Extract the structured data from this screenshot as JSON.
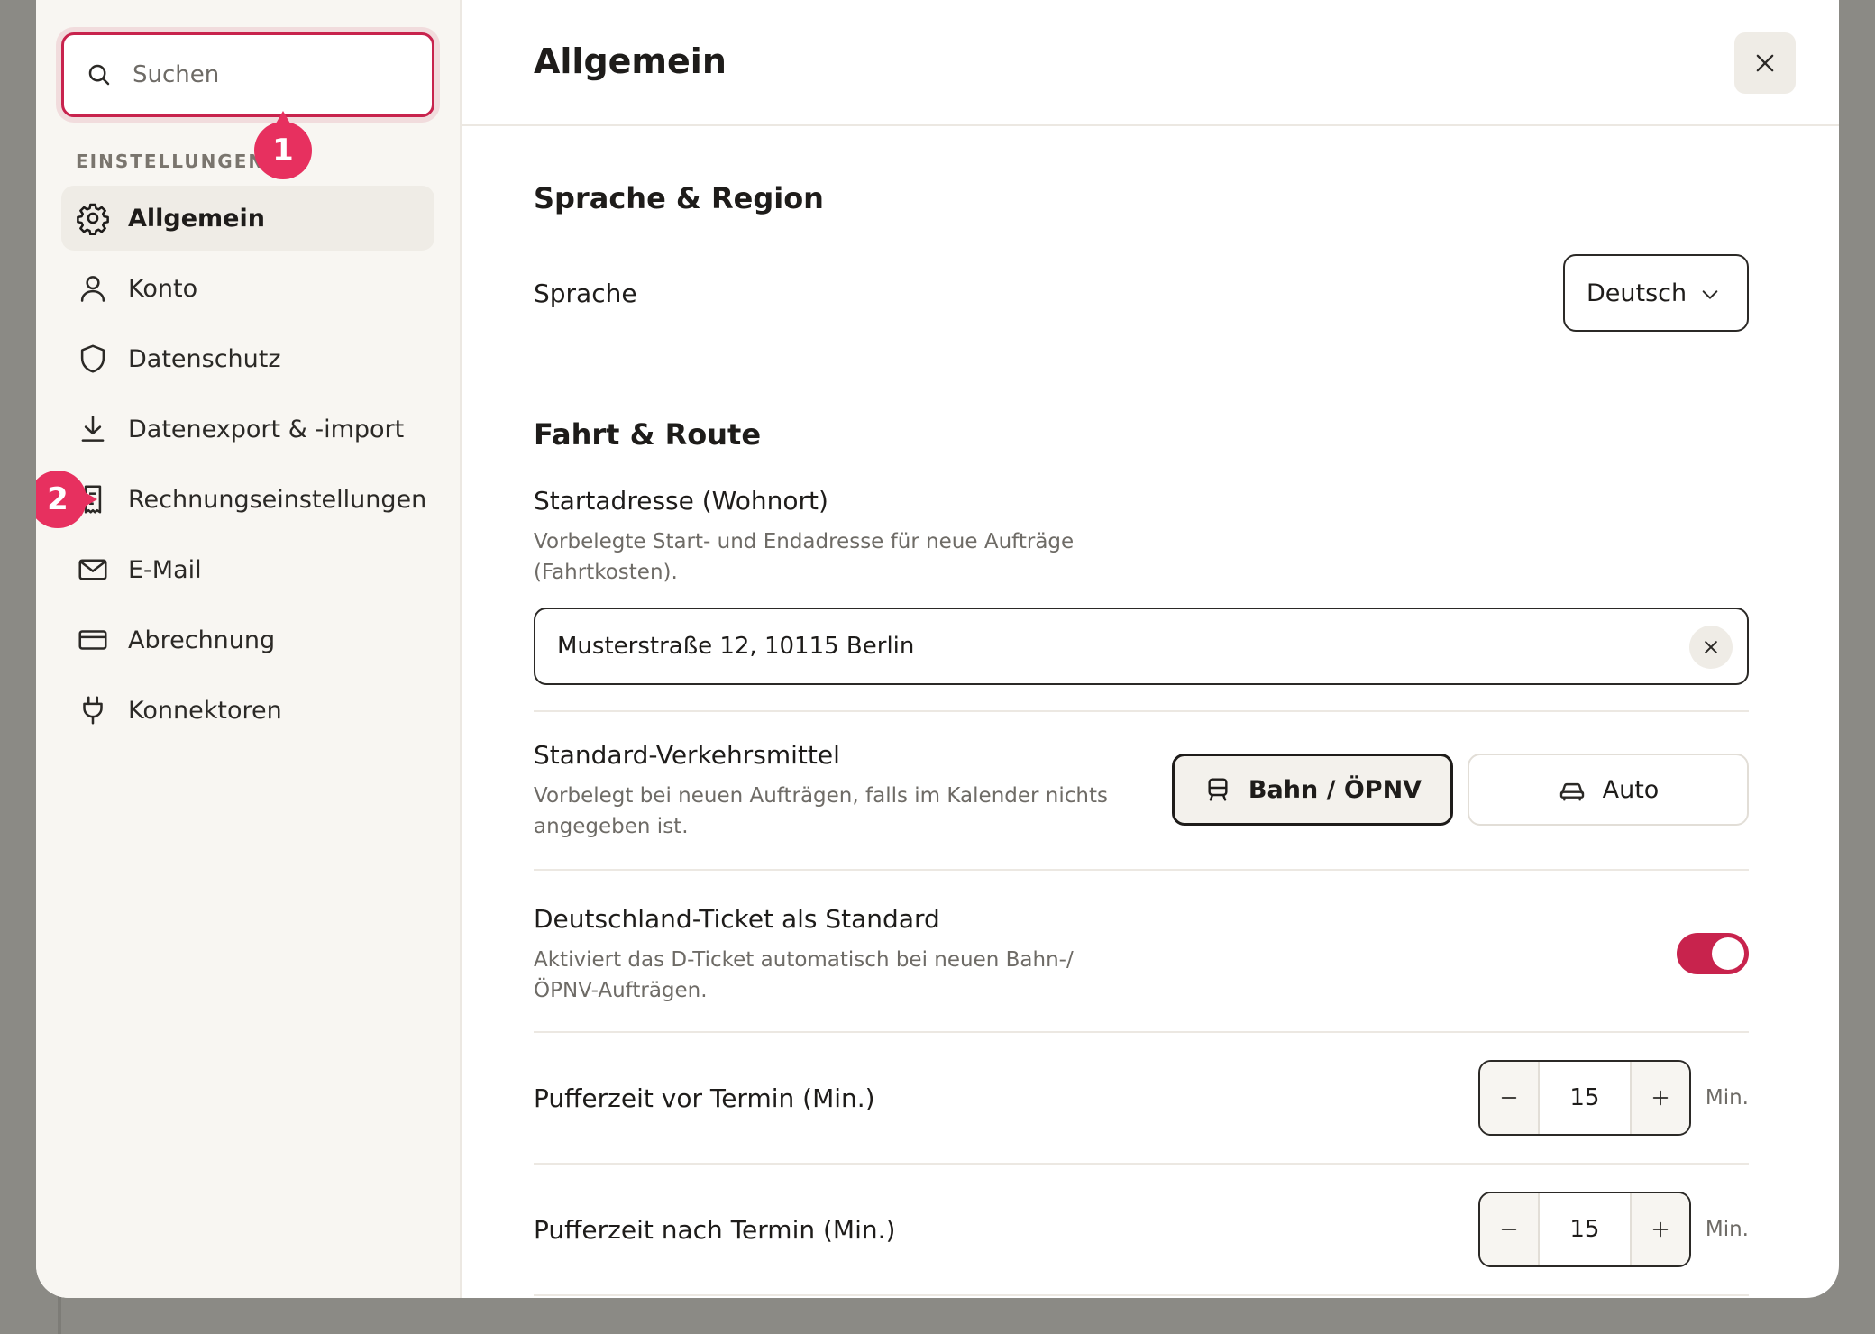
{
  "sidebar": {
    "search_placeholder": "Suchen",
    "section_label": "EINSTELLUNGEN",
    "items": [
      {
        "label": "Allgemein",
        "icon": "gear-icon",
        "active": true
      },
      {
        "label": "Konto",
        "icon": "user-icon"
      },
      {
        "label": "Datenschutz",
        "icon": "shield-icon"
      },
      {
        "label": "Datenexport & -import",
        "icon": "download-icon"
      },
      {
        "label": "Rechnungseinstellungen",
        "icon": "receipt-icon"
      },
      {
        "label": "E-Mail",
        "icon": "mail-icon"
      },
      {
        "label": "Abrechnung",
        "icon": "credit-card-icon"
      },
      {
        "label": "Konnektoren",
        "icon": "plug-icon"
      }
    ]
  },
  "markers": [
    "1",
    "2"
  ],
  "header": {
    "title": "Allgemein"
  },
  "language": {
    "section_title": "Sprache & Region",
    "label": "Sprache",
    "selected": "Deutsch"
  },
  "route": {
    "section_title": "Fahrt & Route",
    "start_address": {
      "title": "Startadresse (Wohnort)",
      "description": "Vorbelegte Start- und Endadresse für neue Aufträge (Fahrtkosten).",
      "value": "Musterstraße 12, 10115 Berlin"
    },
    "transport": {
      "title": "Standard-Verkehrsmittel",
      "description": "Vorbelegt bei neuen Aufträgen, falls im Kalender nichts angegeben ist.",
      "options": [
        {
          "label": "Bahn / ÖPNV",
          "icon": "train-icon",
          "selected": true
        },
        {
          "label": "Auto",
          "icon": "car-icon",
          "selected": false
        }
      ]
    },
    "ticket": {
      "title": "Deutschland-Ticket als Standard",
      "description": "Aktiviert das D-Ticket automatisch bei neuen Bahn-/ÖPNV-Aufträgen.",
      "enabled": true
    },
    "buffer_before": {
      "label": "Pufferzeit vor Termin (Min.)",
      "value": "15",
      "unit": "Min."
    },
    "buffer_after": {
      "label": "Pufferzeit nach Termin (Min.)",
      "value": "15",
      "unit": "Min."
    }
  },
  "colors": {
    "accent": "#c8234d",
    "marker": "#e7305f"
  }
}
